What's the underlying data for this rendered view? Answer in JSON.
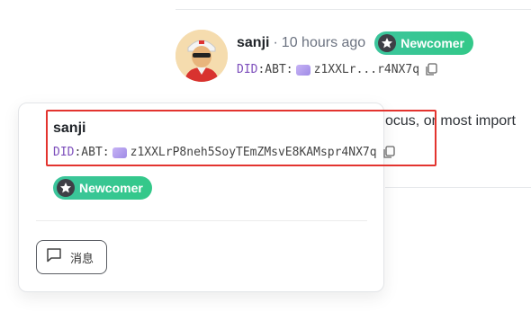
{
  "post": {
    "author": "sanji",
    "separator": "·",
    "time": "10 hours ago",
    "badge": "Newcomer",
    "did_prefix": "DID",
    "did_method": ":ABT:",
    "did_short": "z1XXLr...r4NX7q",
    "snippet": "ocus, or most import"
  },
  "popover": {
    "name": "sanji",
    "did_prefix": "DID",
    "did_method": ":ABT:",
    "did_full": "z1XXLrP8neh5SoyTEmZMsvE8KAMspr4NX7q",
    "badge": "Newcomer",
    "message_label": "消息"
  },
  "icons": {
    "badge": "newcomer-star-icon",
    "did_chip": "did-chip-icon",
    "copy": "copy-icon",
    "message": "chat-bubble-icon"
  },
  "colors": {
    "badge_start": "#3cc59c",
    "badge_end": "#33c889",
    "did_prefix": "#7c4dbb",
    "highlight": "#e3342f"
  }
}
